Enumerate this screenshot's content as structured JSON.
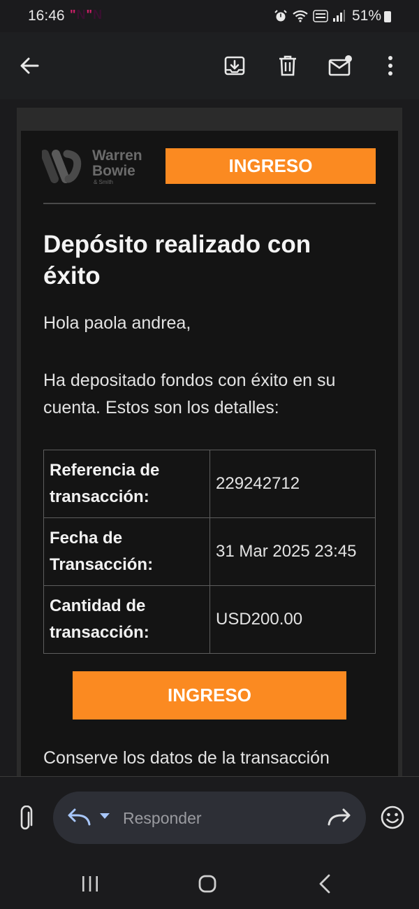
{
  "status_bar": {
    "time": "16:46",
    "notification_marks": [
      "N",
      "N"
    ],
    "battery": "51%",
    "icons": [
      "alarm-icon",
      "wifi-icon",
      "volte-icon",
      "signal-icon",
      "battery-icon"
    ]
  },
  "toolbar": {
    "icons": [
      "back-arrow-icon",
      "archive-icon",
      "trash-icon",
      "mark-unread-icon",
      "more-vert-icon"
    ]
  },
  "email": {
    "logo": {
      "line1": "Warren",
      "line2": "Bowie",
      "line3": "& Smith"
    },
    "top_button": "INGRESO",
    "title": "Depósito realizado con éxito",
    "greeting": "Hola paola andrea,",
    "intro": "Ha depositado fondos con éxito en su cuenta. Estos son los detalles:",
    "details": [
      {
        "label": "Referencia de transacción:",
        "value": "229242712"
      },
      {
        "label": "Fecha de Transacción:",
        "value": "31 Mar 2025 23:45"
      },
      {
        "label": "Cantidad de transacción:",
        "value": "USD200.00"
      }
    ],
    "main_button": "INGRESO",
    "outro": "Conserve los datos de la transacción"
  },
  "reply_bar": {
    "placeholder": "Responder",
    "icons": [
      "attach-icon",
      "reply-icon",
      "dropdown-icon",
      "forward-icon",
      "emoji-icon"
    ]
  },
  "nav_bar": {
    "icons": [
      "recents-icon",
      "home-icon",
      "back-icon"
    ]
  },
  "colors": {
    "accent": "#fb8a21",
    "background": "#1b1b1d",
    "card": "#141414"
  }
}
